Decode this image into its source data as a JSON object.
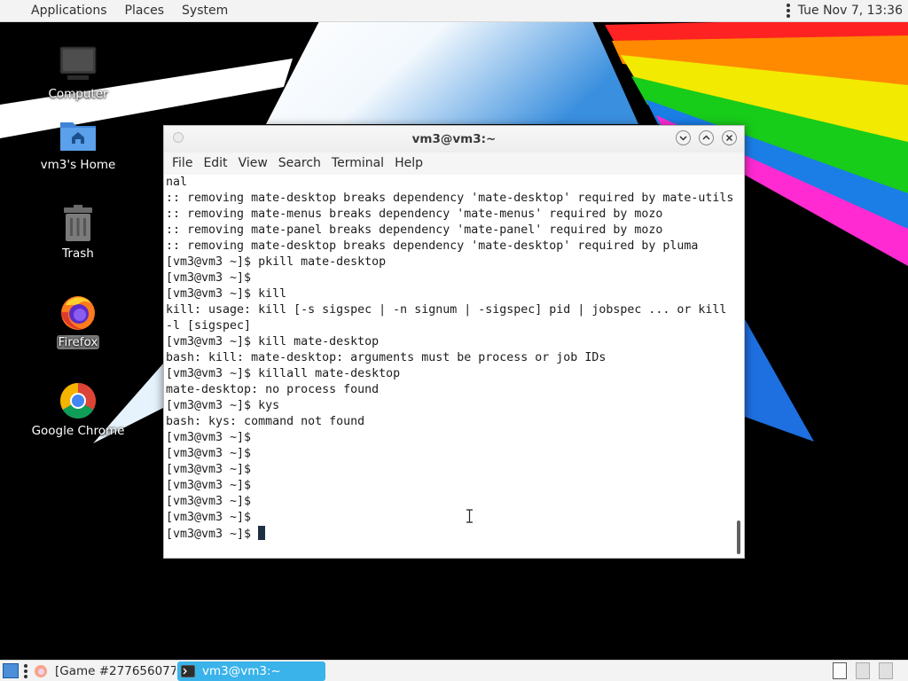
{
  "top_panel": {
    "menus": [
      "Applications",
      "Places",
      "System"
    ],
    "clock": "Tue Nov  7, 13:36"
  },
  "desktop_icons": [
    {
      "label": "Computer",
      "icon": "computer-icon"
    },
    {
      "label": "vm3's Home",
      "icon": "home-folder-icon"
    },
    {
      "label": "Trash",
      "icon": "trash-icon"
    },
    {
      "label": "Firefox",
      "icon": "firefox-icon",
      "selected": true
    },
    {
      "label": "Google Chrome",
      "icon": "chrome-icon"
    }
  ],
  "terminal": {
    "title": "vm3@vm3:~",
    "menu": [
      "File",
      "Edit",
      "View",
      "Search",
      "Terminal",
      "Help"
    ],
    "lines": [
      "nal",
      ":: removing mate-desktop breaks dependency 'mate-desktop' required by mate-utils",
      ":: removing mate-menus breaks dependency 'mate-menus' required by mozo",
      ":: removing mate-panel breaks dependency 'mate-panel' required by mozo",
      ":: removing mate-desktop breaks dependency 'mate-desktop' required by pluma",
      "[vm3@vm3 ~]$ pkill mate-desktop",
      "[vm3@vm3 ~]$",
      "[vm3@vm3 ~]$ kill",
      "kill: usage: kill [-s sigspec | -n signum | -sigspec] pid | jobspec ... or kill",
      "-l [sigspec]",
      "[vm3@vm3 ~]$ kill mate-desktop",
      "bash: kill: mate-desktop: arguments must be process or job IDs",
      "[vm3@vm3 ~]$ killall mate-desktop",
      "mate-desktop: no process found",
      "[vm3@vm3 ~]$ kys",
      "bash: kys: command not found",
      "[vm3@vm3 ~]$",
      "[vm3@vm3 ~]$",
      "[vm3@vm3 ~]$",
      "[vm3@vm3 ~]$",
      "[vm3@vm3 ~]$",
      "[vm3@vm3 ~]$",
      "[vm3@vm3 ~]$"
    ],
    "prompt": "[vm3@vm3 ~]$"
  },
  "taskbar": {
    "tasks": [
      {
        "label": "[Game #277656077...",
        "icon": "firefox-icon",
        "active": false
      },
      {
        "label": "vm3@vm3:~",
        "icon": "terminal-icon",
        "active": true
      }
    ]
  },
  "colors": {
    "panel_bg": "#f3f3f3",
    "active_task": "#39b3ea",
    "terminal_bg": "#ffffff",
    "terminal_fg": "#1c1c1c",
    "cursor": "#1e2f46"
  }
}
